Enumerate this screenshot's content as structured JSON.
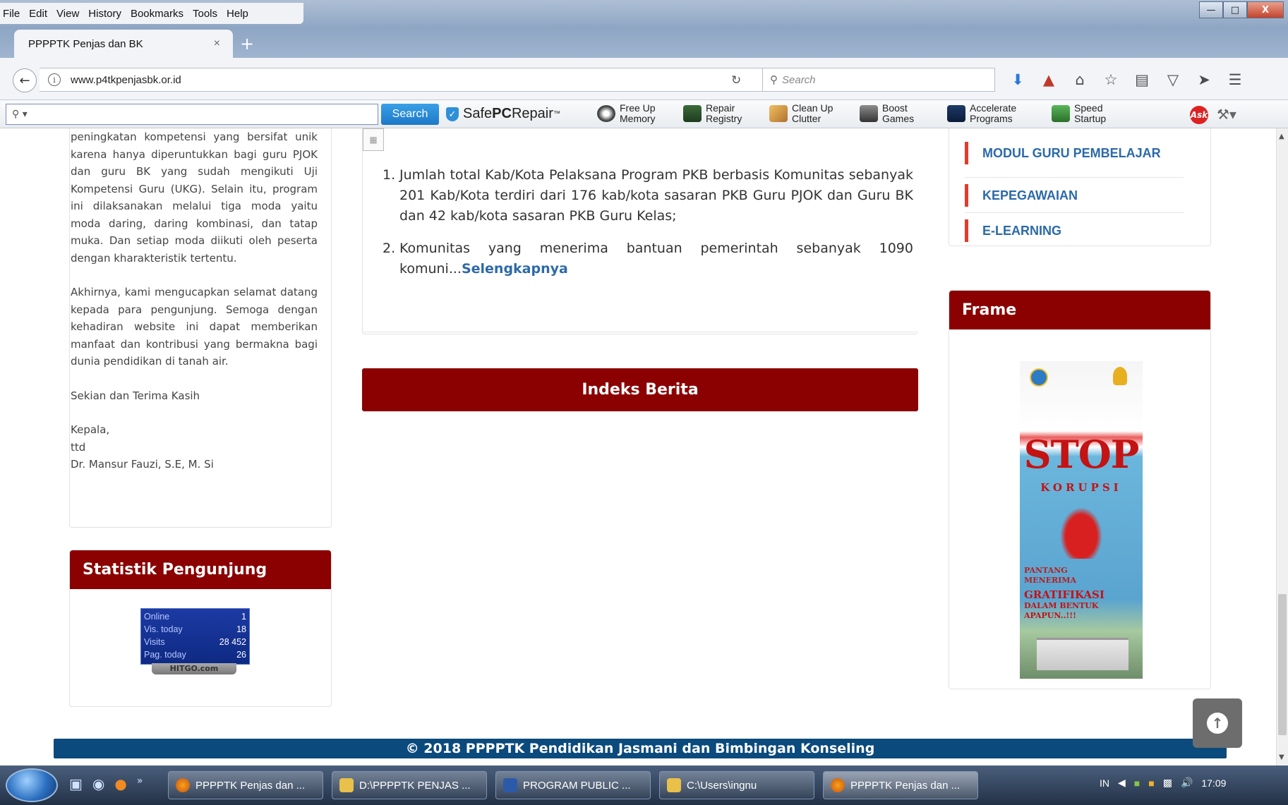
{
  "browser": {
    "menu": [
      "File",
      "Edit",
      "View",
      "History",
      "Bookmarks",
      "Tools",
      "Help"
    ],
    "tab_title": "PPPPTK Penjas dan BK",
    "tab_close": "×",
    "new_tab": "+",
    "url": "www.p4tkpenjasbk.or.id",
    "search_placeholder": "Search",
    "window_controls": {
      "minimize": "—",
      "maximize": "□",
      "close": "X"
    }
  },
  "ask_toolbar": {
    "search_button": "Search",
    "brand_prefix": "Safe",
    "brand_bold": "PC",
    "brand_suffix": "Repair",
    "brand_tm": "™",
    "items": [
      {
        "l1": "Free Up",
        "l2": "Memory"
      },
      {
        "l1": "Repair",
        "l2": "Registry"
      },
      {
        "l1": "Clean Up",
        "l2": "Clutter"
      },
      {
        "l1": "Boost",
        "l2": "Games"
      },
      {
        "l1": "Accelerate",
        "l2": "Programs"
      },
      {
        "l1": "Speed",
        "l2": "Startup"
      }
    ],
    "ask_logo": "Ask"
  },
  "left": {
    "intro": "peningkatan kompetensi yang bersifat unik karena hanya diperuntukkan bagi guru PJOK dan guru BK yang sudah mengikuti Uji Kompetensi Guru (UKG). Selain itu, program ini dilaksanakan melalui tiga moda yaitu moda daring, daring kombinasi, dan tatap muka. Dan setiap moda diikuti oleh peserta dengan kharakteristik tertentu.",
    "closing": "Akhirnya, kami mengucapkan selamat datang kepada para pengunjung. Semoga dengan kehadiran website ini dapat memberikan manfaat dan kontribusi yang bermakna bagi dunia pendidikan di tanah air.",
    "thanks": "Sekian dan Terima Kasih",
    "sign_title": "Kepala,",
    "sign_ttd": "ttd",
    "sign_name": "Dr. Mansur Fauzi, S.E, M. Si"
  },
  "stats": {
    "title": "Statistik Pengunjung",
    "rows": [
      {
        "label": "Online",
        "value": "1"
      },
      {
        "label": "Vis. today",
        "value": "18"
      },
      {
        "label": "Visits",
        "value": "28 452"
      },
      {
        "label": "Pag. today",
        "value": "26"
      }
    ],
    "badge": "HITGO.com"
  },
  "news": {
    "items": [
      {
        "num": "1.",
        "text": "Jumlah total Kab/Kota Pelaksana Program PKB berbasis Komunitas sebanyak 201 Kab/Kota terdiri dari 176 kab/kota sasaran PKB Guru PJOK dan Guru BK dan 42 kab/kota sasaran PKB Guru Kelas;"
      },
      {
        "num": "2.",
        "text": "Komunitas yang menerima bantuan pemerintah sebanyak 1090 komuni...",
        "more": "Selengkapnya"
      }
    ],
    "index_button": "Indeks Berita"
  },
  "side_menu": [
    "MODUL GURU PEMBELAJAR",
    "KEPEGAWAIAN",
    "E-LEARNING"
  ],
  "frame": {
    "title": "Frame",
    "poster_stop": "STOP",
    "poster_korupsi": "KORUPSI",
    "poster_line1": "PANTANG",
    "poster_line2": "MENERIMA",
    "poster_line3": "GRATIFIKASI",
    "poster_line4": "DALAM BENTUK",
    "poster_line5": "APAPUN..!!!"
  },
  "footer": "© 2018 PPPPTK Pendidikan Jasmani dan Bimbingan Konseling",
  "taskbar": {
    "items": [
      "PPPPTK Penjas dan ...",
      "D:\\PPPPTK PENJAS ...",
      "PROGRAM PUBLIC ...",
      "C:\\Users\\ingnu",
      "PPPPTK Penjas dan ..."
    ],
    "lang": "IN",
    "clock": "17:09"
  }
}
